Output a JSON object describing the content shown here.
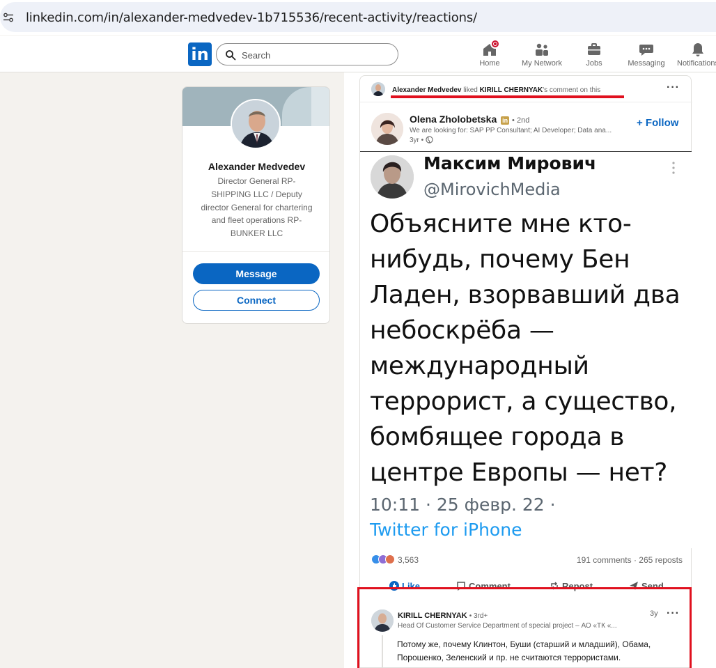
{
  "browser": {
    "url": "linkedin.com/in/alexander-medvedev-1b715536/recent-activity/reactions/"
  },
  "nav": {
    "logo_text": "in",
    "search_placeholder": "Search",
    "items": [
      {
        "label": "Home",
        "icon": "home-icon"
      },
      {
        "label": "My Network",
        "icon": "network-icon"
      },
      {
        "label": "Jobs",
        "icon": "briefcase-icon"
      },
      {
        "label": "Messaging",
        "icon": "messaging-icon"
      },
      {
        "label": "Notifications",
        "icon": "bell-icon"
      }
    ],
    "brand_color": "#0a66c2",
    "badge_color": "#cb112d"
  },
  "profile": {
    "name": "Alexander Medvedev",
    "headline": "Director General RP-SHIPPING LLC / Deputy director General for chartering and fleet operations RP-BUNKER LLC",
    "message_label": "Message",
    "connect_label": "Connect"
  },
  "activity": {
    "actor": "Alexander Medvedev",
    "verb": "liked",
    "target": "KIRILL CHERNYAK",
    "suffix": "'s comment on this",
    "highlight_color": "#e0101e"
  },
  "post": {
    "author": "Olena Zholobetska",
    "premium_badge": "in",
    "degree": "2nd",
    "headline": "We are looking for: SAP PP Consultant; AI Developer; Data ana...",
    "time": "3yr",
    "follow_label": "+ Follow",
    "tweet": {
      "name": "Максим Мирович",
      "handle": "@MirovichMedia",
      "text": "Объясните мне кто-нибудь, почему Бен Ладен, взорвавший два небоскрёба — международный террорист, а существо, бомбящее города в центре Европы — нет?",
      "meta": "10:11 · 25 февр. 22 ·",
      "source": "Twitter for iPhone"
    },
    "reaction_count": "3,563",
    "stats": "191 comments · 265 reposts",
    "actions": [
      "Like",
      "Comment",
      "Repost",
      "Send"
    ]
  },
  "comment": {
    "author": "KIRILL CHERNYAK",
    "degree": "3rd+",
    "headline": "Head Of Customer Service Department of special project – АО «ТК «...",
    "time": "3y",
    "text": "Потому же, почему Клинтон, Буши (старший и младший), Обама, Порошенко, Зеленский и пр. не считаются террористами."
  }
}
